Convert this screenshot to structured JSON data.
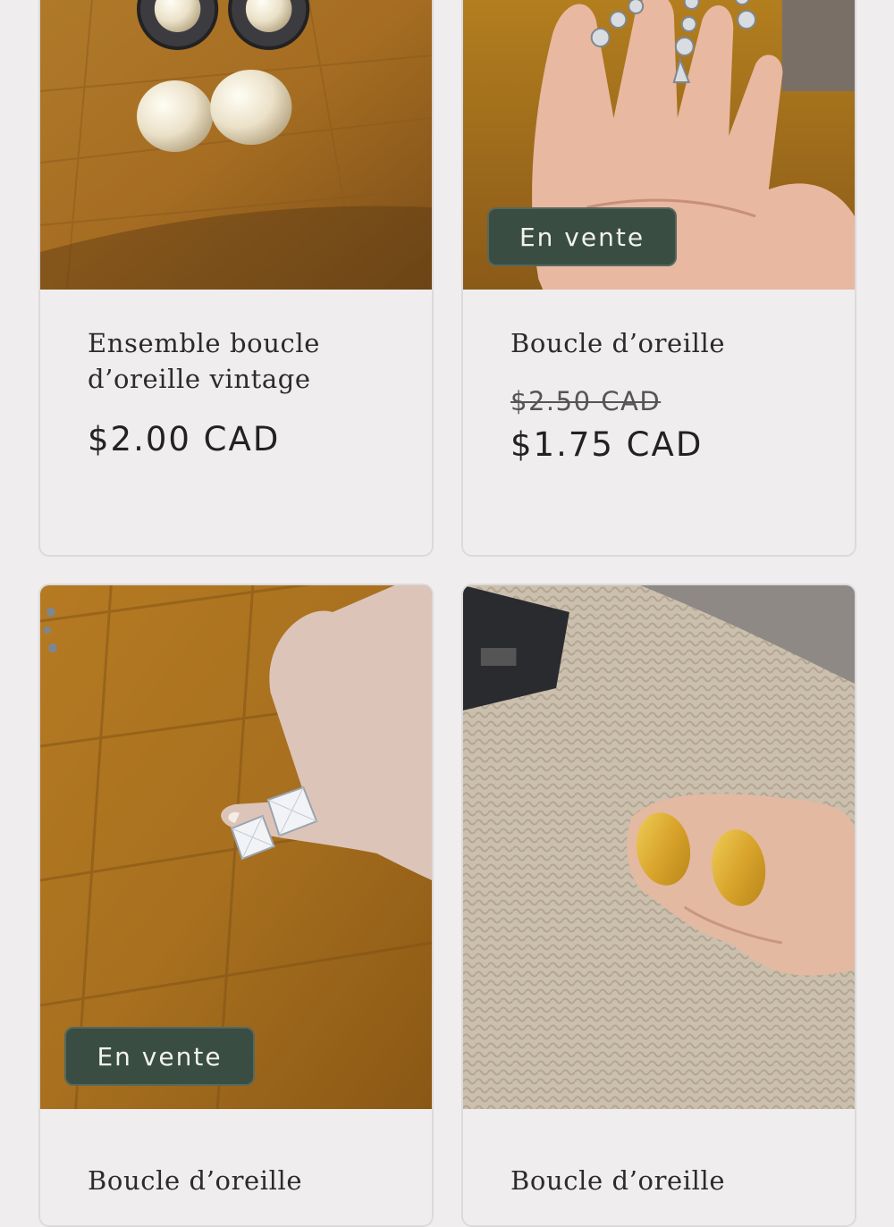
{
  "products": [
    {
      "title": "Ensemble boucle d’oreille vintage",
      "price": "$2.00 CAD",
      "image_alt": "pearl-earrings-on-wood"
    },
    {
      "title": "Boucle d’oreille",
      "compare_price": "$2.50 CAD",
      "price": "$1.75 CAD",
      "badge": "En vente",
      "image_alt": "dangling-crystal-earrings-in-hand"
    },
    {
      "title": "Boucle d’oreille",
      "badge": "En vente",
      "image_alt": "square-crystal-studs-held-in-fingers"
    },
    {
      "title": "Boucle d’oreille",
      "image_alt": "gold-oval-earrings-held-over-knit"
    }
  ],
  "colors": {
    "background": "#efedee",
    "badge_bg": "#3a4d42",
    "badge_text": "#f2f2ee",
    "text": "#2b2b2b"
  }
}
